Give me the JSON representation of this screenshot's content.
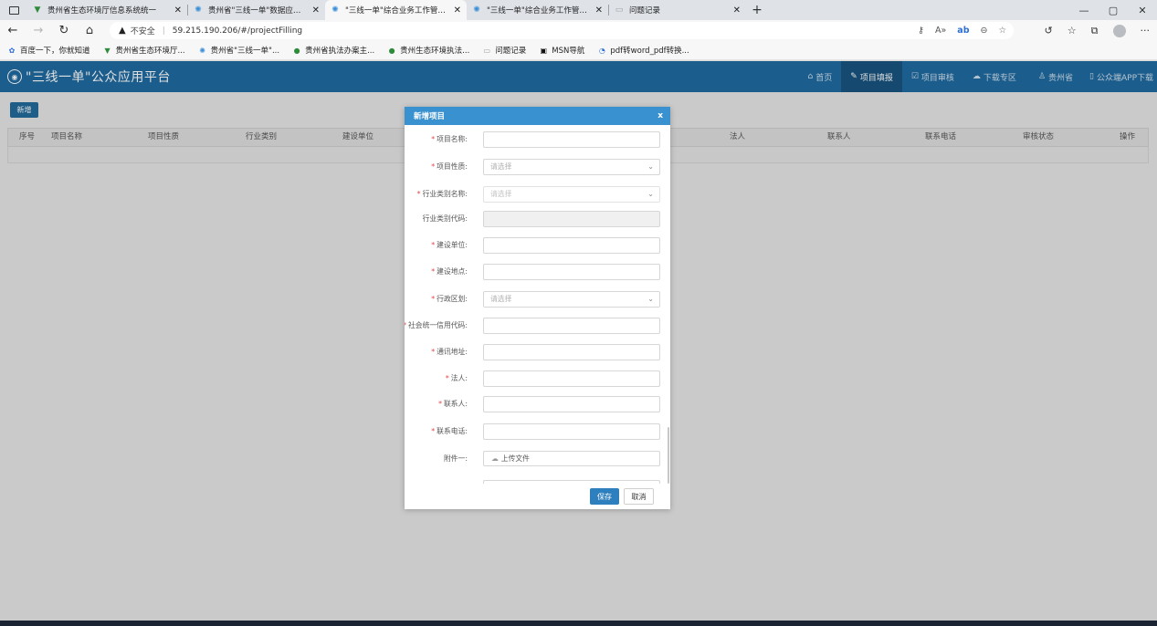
{
  "browser": {
    "tabs": [
      {
        "label": "贵州省生态环境厅信息系统统一",
        "favicon": "green-v-icon",
        "active": false
      },
      {
        "label": "贵州省\"三线一单\"数据应用管理平",
        "favicon": "globe-icon",
        "active": false
      },
      {
        "label": "\"三线一单\"综合业务工作管理平台",
        "favicon": "globe-icon",
        "active": true
      },
      {
        "label": "\"三线一单\"综合业务工作管理平台",
        "favicon": "globe-icon",
        "active": false
      },
      {
        "label": "问题记录",
        "favicon": "page-icon",
        "active": false
      }
    ],
    "new_tab": "+",
    "window_controls": [
      "—",
      "▢",
      "✕"
    ],
    "address": {
      "security_label": "不安全",
      "url": "59.215.190.206/#/projectFilling"
    },
    "bookmarks": [
      {
        "label": "百度一下，你就知道",
        "icon": "baidu-paw-icon",
        "color": "#2f6fd6"
      },
      {
        "label": "贵州省生态环境厅...",
        "icon": "green-v-icon",
        "color": "#2e8b3a"
      },
      {
        "label": "贵州省\"三线一单\"...",
        "icon": "globe-icon",
        "color": "#3b8fd9"
      },
      {
        "label": "贵州省执法办案主...",
        "icon": "green-dot-icon",
        "color": "#2e8b3a"
      },
      {
        "label": "贵州生态环境执法...",
        "icon": "green-dot-icon",
        "color": "#2e8b3a"
      },
      {
        "label": "问题记录",
        "icon": "page-icon",
        "color": "#9aa0a6"
      },
      {
        "label": "MSN导航",
        "icon": "msn-icon",
        "color": "#111111"
      },
      {
        "label": "pdf转word_pdf转换...",
        "icon": "blue-circle-icon",
        "color": "#2f6fd6"
      }
    ]
  },
  "app": {
    "title": "\"三线一单\"公众应用平台",
    "nav": [
      {
        "label": "首页",
        "icon": "home-icon",
        "active": false
      },
      {
        "label": "项目填报",
        "icon": "edit-icon",
        "active": true
      },
      {
        "label": "项目审核",
        "icon": "check-doc-icon",
        "active": false
      },
      {
        "label": "下载专区",
        "icon": "cloud-download-icon",
        "active": false
      },
      {
        "label": "贵州省",
        "icon": "user-icon",
        "active": false
      },
      {
        "label": "公众端APP下载",
        "icon": "phone-icon",
        "active": false
      }
    ],
    "add_button": "新增",
    "table": {
      "columns": [
        "序号",
        "项目名称",
        "项目性质",
        "行业类别",
        "建设单位",
        "法人",
        "联系人",
        "联系电话",
        "审核状态",
        "操作"
      ]
    }
  },
  "modal": {
    "title": "新增项目",
    "close": "x",
    "fields": [
      {
        "label": "项目名称:",
        "required": true,
        "type": "text",
        "value": "",
        "placeholder": ""
      },
      {
        "label": "项目性质:",
        "required": true,
        "type": "select",
        "value": "",
        "placeholder": "请选择"
      },
      {
        "label": "行业类别名称:",
        "required": true,
        "type": "select-dim",
        "value": "",
        "placeholder": "请选择"
      },
      {
        "label": "行业类别代码:",
        "required": false,
        "type": "disabled",
        "value": "",
        "placeholder": ""
      },
      {
        "label": "建设单位:",
        "required": true,
        "type": "text",
        "value": "",
        "placeholder": ""
      },
      {
        "label": "建设地点:",
        "required": true,
        "type": "text",
        "value": "",
        "placeholder": ""
      },
      {
        "label": "行政区划:",
        "required": true,
        "type": "select",
        "value": "",
        "placeholder": "请选择"
      },
      {
        "label": "社会统一信用代码:",
        "required": true,
        "type": "text",
        "value": "",
        "placeholder": ""
      },
      {
        "label": "通讯地址:",
        "required": true,
        "type": "text",
        "value": "",
        "placeholder": ""
      },
      {
        "label": "法人:",
        "required": true,
        "type": "text",
        "value": "",
        "placeholder": ""
      },
      {
        "label": "联系人:",
        "required": true,
        "type": "text",
        "value": "",
        "placeholder": ""
      },
      {
        "label": "联系电话:",
        "required": true,
        "type": "text",
        "value": "",
        "placeholder": ""
      }
    ],
    "attachment": {
      "label": "附件一:",
      "button": "上传文件"
    },
    "save": "保存",
    "cancel": "取消"
  }
}
